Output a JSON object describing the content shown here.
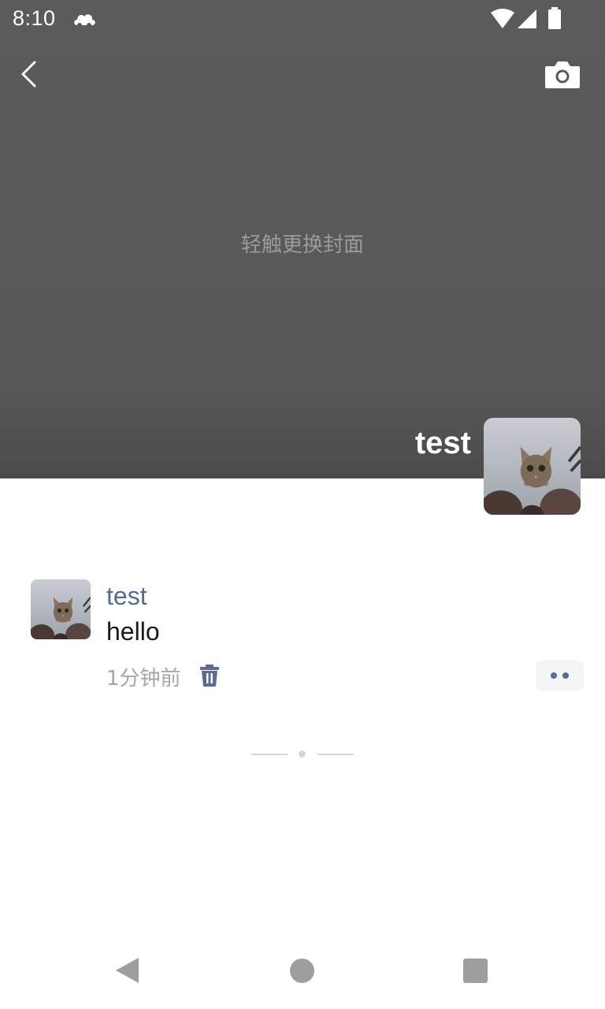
{
  "status_bar": {
    "time": "8:10",
    "icons": [
      "cloud-app-icon",
      "wifi-icon",
      "signal-icon",
      "battery-icon"
    ]
  },
  "toolbar": {
    "back_icon": "back-arrow-icon",
    "camera_icon": "camera-icon"
  },
  "cover": {
    "hint": "轻触更换封面",
    "profile_name": "test"
  },
  "feed": {
    "posts": [
      {
        "author": "test",
        "content": "hello",
        "time": "1分钟前",
        "delete_icon": "trash-icon",
        "more_icon": "more-dots-icon"
      }
    ]
  },
  "nav_bar": {
    "icons": [
      "nav-back-icon",
      "nav-home-icon",
      "nav-recents-icon"
    ]
  },
  "colors": {
    "cover_bg": "#595959",
    "link_blue": "#576b95",
    "muted_text": "#a5a5a5",
    "nav_gray": "#9e9e9e"
  }
}
